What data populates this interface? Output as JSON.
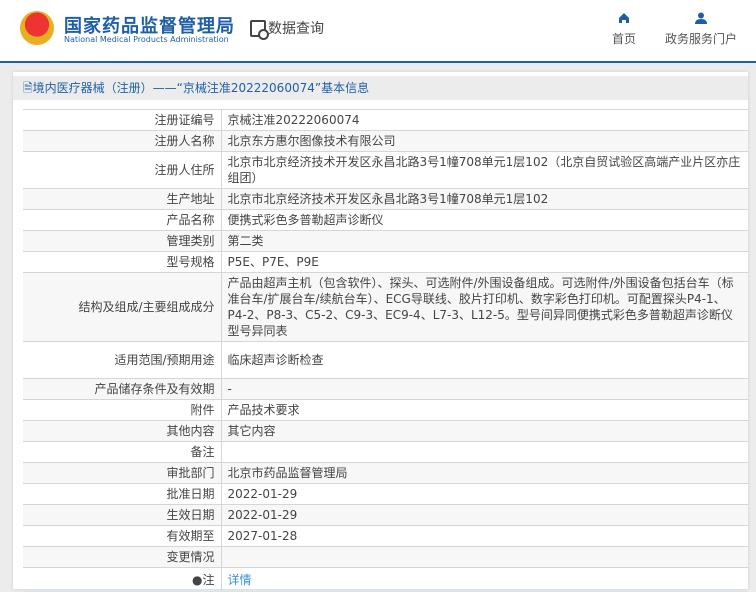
{
  "header": {
    "logo_cn": "国家药品监督管理局",
    "logo_en": "National Medical Products Administration",
    "query_label": "数据查询",
    "nav": [
      {
        "label": "首页",
        "icon": "home-icon"
      },
      {
        "label": "政务服务门户",
        "icon": "user-icon"
      }
    ]
  },
  "title": "境内医疗器械（注册）——“京械注准20222060074”基本信息",
  "rows": [
    {
      "label": "注册证编号",
      "value": "京械注准20222060074"
    },
    {
      "label": "注册人名称",
      "value": "北京东方惠尔图像技术有限公司"
    },
    {
      "label": "注册人住所",
      "value": "北京市北京经济技术开发区永昌北路3号1幢708单元1层102（北京自贸试验区高端产业片区亦庄组团）"
    },
    {
      "label": "生产地址",
      "value": "北京市北京经济技术开发区永昌北路3号1幢708单元1层102"
    },
    {
      "label": "产品名称",
      "value": "便携式彩色多普勒超声诊断仪"
    },
    {
      "label": "管理类别",
      "value": "第二类"
    },
    {
      "label": "型号规格",
      "value": "P5E、P7E、P9E"
    },
    {
      "label": "结构及组成/主要组成成分",
      "value": "产品由超声主机（包含软件）、探头、可选附件/外围设备组成。可选附件/外围设备包括台车（标准台车/扩展台车/续航台车）、ECG导联线、胶片打印机、数字彩色打印机。可配置探头P4-1、P4-2、P8-3、C5-2、C9-3、EC9-4、L7-3、L12-5。型号间异同便携式彩色多普勒超声诊断仪型号异同表"
    },
    {
      "label": "适用范围/预期用途",
      "value": "临床超声诊断检查"
    },
    {
      "label": "产品储存条件及有效期",
      "value": "-"
    },
    {
      "label": "附件",
      "value": "产品技术要求"
    },
    {
      "label": "其他内容",
      "value": "其它内容"
    },
    {
      "label": "备注",
      "value": ""
    },
    {
      "label": "审批部门",
      "value": "北京市药品监督管理局"
    },
    {
      "label": "批准日期",
      "value": "2022-01-29"
    },
    {
      "label": "生效日期",
      "value": "2022-01-29"
    },
    {
      "label": "有效期至",
      "value": "2027-01-28"
    },
    {
      "label": "变更情况",
      "value": ""
    }
  ],
  "note": {
    "label": "注",
    "link": "详情"
  }
}
